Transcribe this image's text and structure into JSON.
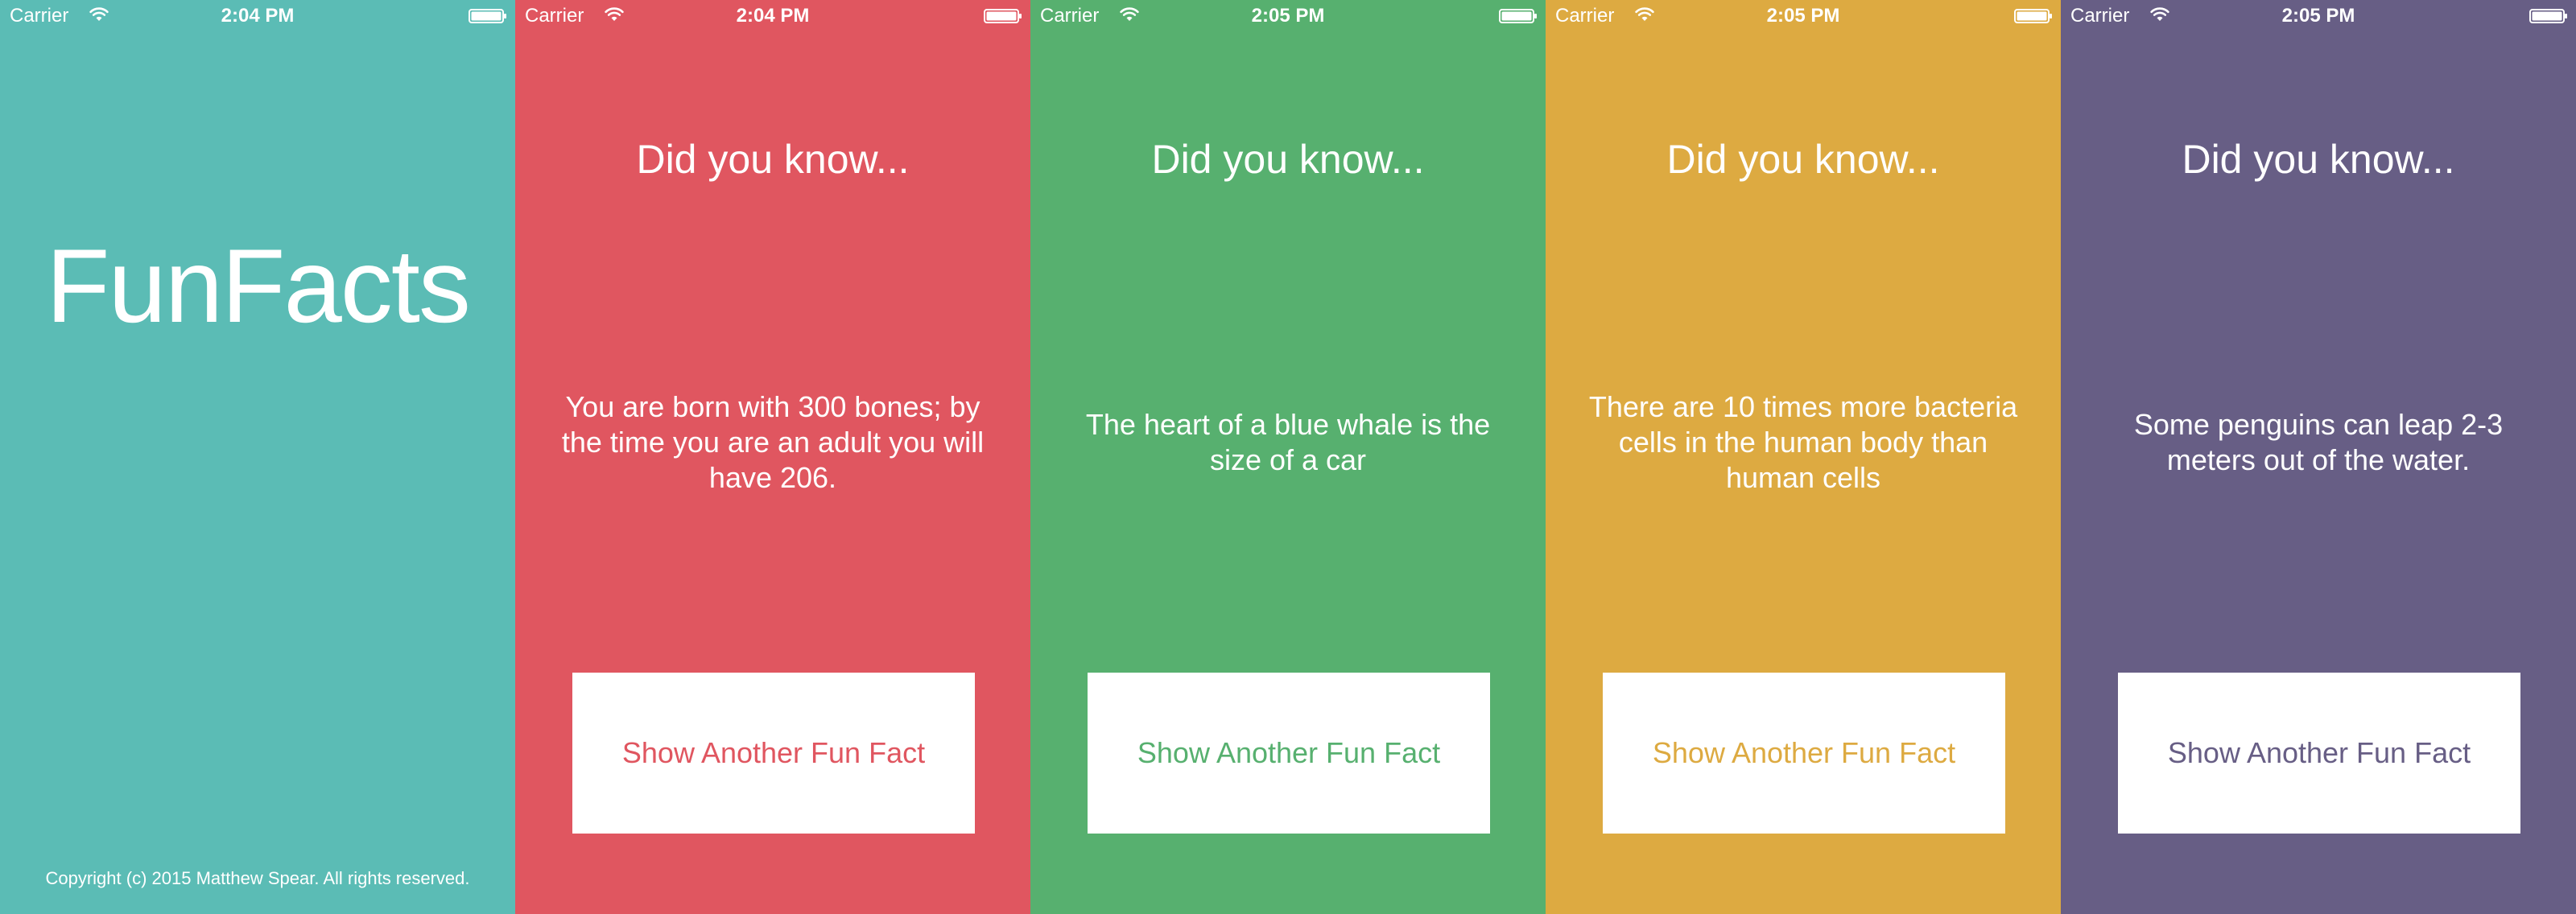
{
  "screens": [
    {
      "status": {
        "carrier": "Carrier",
        "time": "2:04 PM"
      },
      "background_color": "#5bbcb5",
      "app_title": "FunFacts",
      "copyright": "Copyright (c) 2015 Matthew Spear. All rights reserved."
    },
    {
      "status": {
        "carrier": "Carrier",
        "time": "2:04 PM"
      },
      "background_color": "#e05660",
      "heading": "Did you know...",
      "fact": "You are born with 300 bones; by the time you are an adult you will have 206.",
      "button_label": "Show Another Fun Fact"
    },
    {
      "status": {
        "carrier": "Carrier",
        "time": "2:05 PM"
      },
      "background_color": "#57b06f",
      "heading": "Did you know...",
      "fact": "The heart of a blue whale is the size of a car",
      "button_label": "Show Another Fun Fact"
    },
    {
      "status": {
        "carrier": "Carrier",
        "time": "2:05 PM"
      },
      "background_color": "#ddaa41",
      "heading": "Did you know...",
      "fact": "There are 10 times more bacteria cells in the human body than human cells",
      "button_label": "Show Another Fun Fact"
    },
    {
      "status": {
        "carrier": "Carrier",
        "time": "2:05 PM"
      },
      "background_color": "#675e85",
      "heading": "Did you know...",
      "fact": "Some penguins can leap 2-3 meters out of the water.",
      "button_label": "Show Another Fun Fact"
    }
  ],
  "icons": {
    "wifi": "wifi-icon",
    "battery": "battery-icon"
  }
}
